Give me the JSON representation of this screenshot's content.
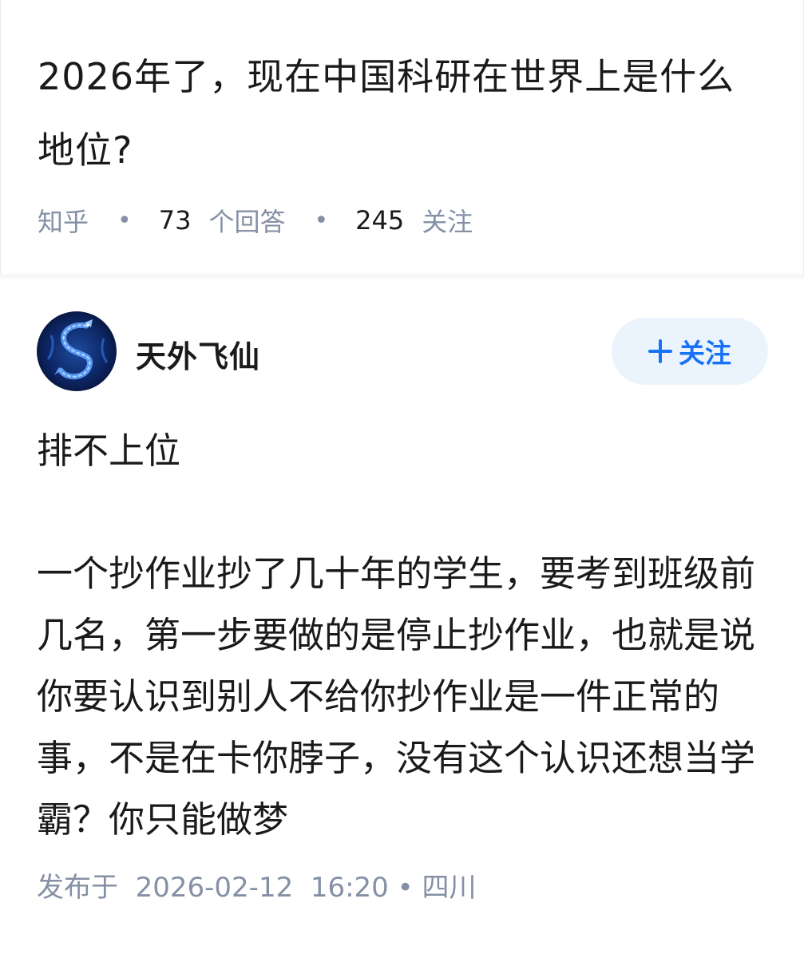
{
  "question": {
    "title": "2026年了，现在中国科研在世界上是什么地位?",
    "source": "知乎",
    "answer_count": "73",
    "answer_count_label": "个回答",
    "follower_count": "245",
    "follower_label": "关注"
  },
  "answer": {
    "author": {
      "name": "天外飞仙",
      "avatar_icon": "dragon-avatar-icon"
    },
    "follow_button": {
      "label": "关注",
      "icon": "plus-icon"
    },
    "paragraphs": [
      "排不上位",
      "一个抄作业抄了几十年的学生，要考到班级前几名，第一步要做的是停止抄作业，也就是说你要认识到别人不给你抄作业是一件正常的事，不是在卡你脖子，没有这个认识还想当学霸？你只能做梦"
    ],
    "publish_label": "发布于",
    "publish_datetime": "2026-02-12  16:20",
    "location": "四川"
  },
  "colors": {
    "text_primary": "#1a1a1a",
    "text_secondary": "#8590a6",
    "accent": "#1772f6",
    "follow_bg": "#ebf4fd"
  }
}
